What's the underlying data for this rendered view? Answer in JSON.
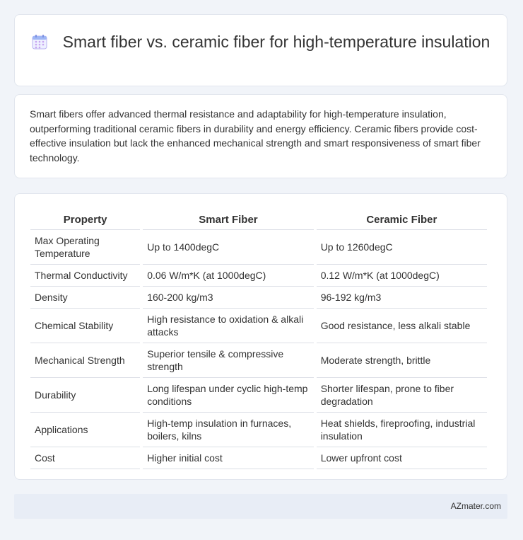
{
  "header": {
    "icon": "calendar-icon",
    "title": "Smart fiber vs. ceramic fiber for high-temperature insulation"
  },
  "summary": {
    "text": "Smart fibers offer advanced thermal resistance and adaptability for high-temperature insulation, outperforming traditional ceramic fibers in durability and energy efficiency. Ceramic fibers provide cost-effective insulation but lack the enhanced mechanical strength and smart responsiveness of smart fiber technology."
  },
  "table": {
    "headers": [
      "Property",
      "Smart Fiber",
      "Ceramic Fiber"
    ],
    "rows": [
      [
        "Max Operating Temperature",
        "Up to 1400degC",
        "Up to 1260degC"
      ],
      [
        "Thermal Conductivity",
        "0.06 W/m*K (at 1000degC)",
        "0.12 W/m*K (at 1000degC)"
      ],
      [
        "Density",
        "160-200 kg/m3",
        "96-192 kg/m3"
      ],
      [
        "Chemical Stability",
        "High resistance to oxidation & alkali attacks",
        "Good resistance, less alkali stable"
      ],
      [
        "Mechanical Strength",
        "Superior tensile & compressive strength",
        "Moderate strength, brittle"
      ],
      [
        "Durability",
        "Long lifespan under cyclic high-temp conditions",
        "Shorter lifespan, prone to fiber degradation"
      ],
      [
        "Applications",
        "High-temp insulation in furnaces, boilers, kilns",
        "Heat shields, fireproofing, industrial insulation"
      ],
      [
        "Cost",
        "Higher initial cost",
        "Lower upfront cost"
      ]
    ]
  },
  "footer": {
    "brand": "AZmater.com"
  }
}
